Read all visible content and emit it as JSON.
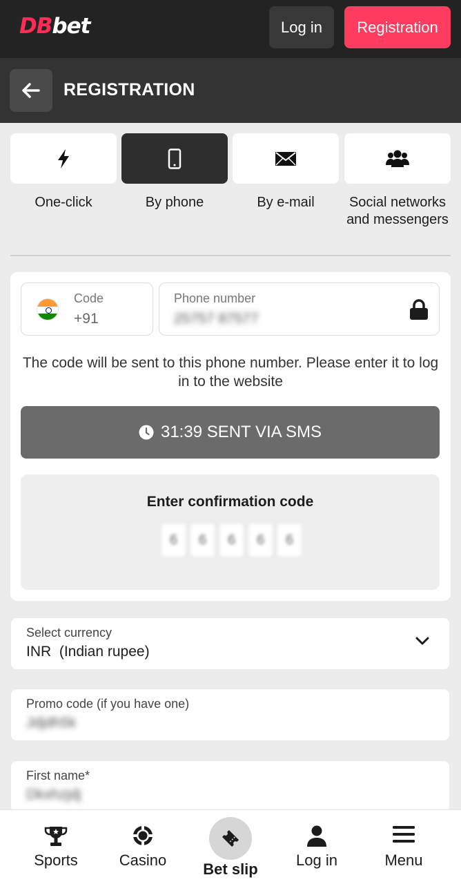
{
  "header": {
    "logo_db": "DB",
    "logo_bet": "bet",
    "login_label": "Log in",
    "register_label": "Registration"
  },
  "titlebar": {
    "title": "REGISTRATION",
    "back_icon": "arrow-left-icon"
  },
  "methods": [
    {
      "label": "One-click",
      "icon": "lightning-icon",
      "active": false
    },
    {
      "label": "By phone",
      "icon": "smartphone-icon",
      "active": true
    },
    {
      "label": "By e-mail",
      "icon": "envelope-icon",
      "active": false
    },
    {
      "label": "Social networks and messengers",
      "icon": "users-icon",
      "active": false
    }
  ],
  "phone_form": {
    "code_label": "Code",
    "code_value": "+91",
    "phone_label": "Phone number",
    "phone_value": "25757 87577",
    "hint": "The code will be sent to this phone number. Please enter it to log in to the website",
    "sms_status": "31:39 SENT VIA SMS",
    "confirm_title": "Enter confirmation code",
    "code_digits": [
      "6",
      "6",
      "6",
      "6",
      "6"
    ]
  },
  "currency": {
    "label": "Select currency",
    "value": "INR  (Indian rupee)"
  },
  "promo": {
    "label": "Promo code (if you have one)",
    "value": "Jdjdh5k"
  },
  "first_name": {
    "label": "First name*",
    "value": "Dkxhzjdj"
  },
  "bottom_nav": {
    "sports": "Sports",
    "casino": "Casino",
    "bet_slip": "Bet slip",
    "login": "Log in",
    "menu": "Menu"
  },
  "colors": {
    "brand": "#ff3b5f",
    "header_bg": "#232323",
    "titlebar_bg": "#333333",
    "sms_button": "#6b6b6b"
  }
}
